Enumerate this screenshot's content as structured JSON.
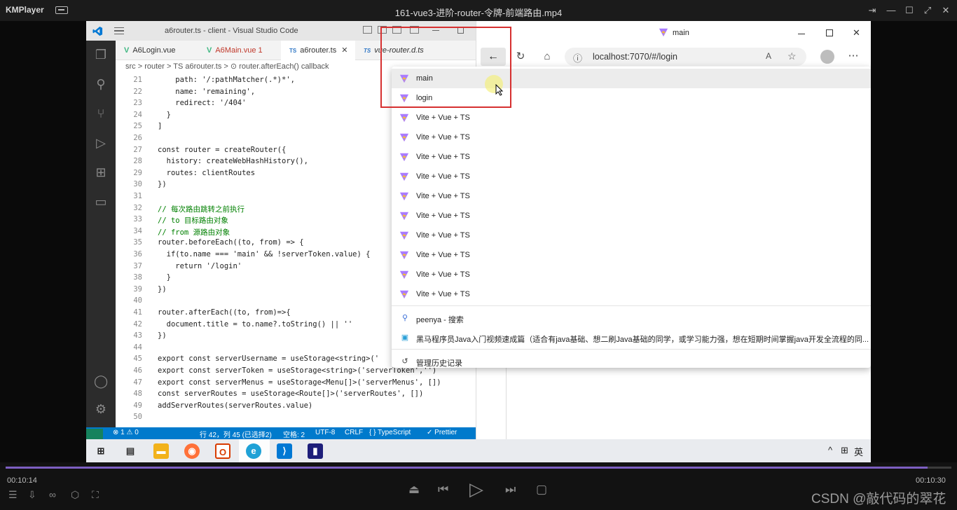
{
  "player": {
    "app_name": "KMPlayer",
    "video_title": "161-vue3-进阶-router-令牌-前端路由.mp4",
    "time_current": "00:10:14",
    "time_total": "00:10:30",
    "progress_fraction": 0.975,
    "watermark": "CSDN @敲代码的翠花"
  },
  "vscode": {
    "window_title": "a6router.ts - client - Visual Studio Code",
    "tabs": [
      {
        "kind": "V",
        "label": "A6Login.vue"
      },
      {
        "kind": "V",
        "label": "A6Main.vue 1"
      },
      {
        "kind": "TS",
        "label": "a6router.ts"
      },
      {
        "kind": "TS",
        "label": "vue-router.d.ts"
      }
    ],
    "breadcrumb": "src  >  router  >  TS  a6router.ts  >  ⊙ router.afterEach() callback",
    "code_lines": [
      {
        "n": "21",
        "t": "    path: '/:pathMatcher(.*)*',"
      },
      {
        "n": "22",
        "t": "    name: 'remaining',"
      },
      {
        "n": "23",
        "t": "    redirect: '/404'"
      },
      {
        "n": "24",
        "t": "  }"
      },
      {
        "n": "25",
        "t": "]"
      },
      {
        "n": "26",
        "t": ""
      },
      {
        "n": "27",
        "t": "const router = createRouter({"
      },
      {
        "n": "28",
        "t": "  history: createWebHashHistory(),"
      },
      {
        "n": "29",
        "t": "  routes: clientRoutes"
      },
      {
        "n": "30",
        "t": "})"
      },
      {
        "n": "31",
        "t": ""
      },
      {
        "n": "32",
        "t": "// 每次路由跳转之前执行"
      },
      {
        "n": "33",
        "t": "// to 目标路由对象"
      },
      {
        "n": "34",
        "t": "// from 源路由对象"
      },
      {
        "n": "35",
        "t": "router.beforeEach((to, from) => {"
      },
      {
        "n": "36",
        "t": "  if(to.name === 'main' && !serverToken.value) {"
      },
      {
        "n": "37",
        "t": "    return '/login'"
      },
      {
        "n": "38",
        "t": "  }"
      },
      {
        "n": "39",
        "t": "})"
      },
      {
        "n": "40",
        "t": ""
      },
      {
        "n": "41",
        "t": "router.afterEach((to, from)=>{"
      },
      {
        "n": "42",
        "t": "  document.title = to.name?.toString() || ''"
      },
      {
        "n": "43",
        "t": "})"
      },
      {
        "n": "44",
        "t": ""
      },
      {
        "n": "45",
        "t": "export const serverUsername = useStorage<string>('"
      },
      {
        "n": "46",
        "t": "export const serverToken = useStorage<string>('serverToken','')"
      },
      {
        "n": "47",
        "t": "export const serverMenus = useStorage<Menu[]>('serverMenus', [])"
      },
      {
        "n": "48",
        "t": "const serverRoutes = useStorage<Route[]>('serverRoutes', [])"
      },
      {
        "n": "49",
        "t": "addServerRoutes(serverRoutes.value)"
      },
      {
        "n": "50",
        "t": ""
      }
    ],
    "status": {
      "problems": "⊗ 1 ⚠ 0",
      "position": "行 42，列 45 (已选择2)",
      "spaces": "空格: 2",
      "encoding": "UTF-8",
      "eol": "CRLF",
      "language": "{ } TypeScript",
      "prettier": "✓ Prettier"
    }
  },
  "browser": {
    "tab_title": "main",
    "url": "localhost:7070/#/login",
    "history_items": [
      {
        "label": "main",
        "selected": true
      },
      {
        "label": "login",
        "selected": false
      },
      {
        "label": "Vite + Vue + TS",
        "selected": false
      },
      {
        "label": "Vite + Vue + TS",
        "selected": false
      },
      {
        "label": "Vite + Vue + TS",
        "selected": false
      },
      {
        "label": "Vite + Vue + TS",
        "selected": false
      },
      {
        "label": "Vite + Vue + TS",
        "selected": false
      },
      {
        "label": "Vite + Vue + TS",
        "selected": false
      },
      {
        "label": "Vite + Vue + TS",
        "selected": false
      },
      {
        "label": "Vite + Vue + TS",
        "selected": false
      },
      {
        "label": "Vite + Vue + TS",
        "selected": false
      },
      {
        "label": "Vite + Vue + TS",
        "selected": false
      }
    ],
    "search_item": "peenya - 搜索",
    "video_item": "黑马程序员Java入门视频速成篇（适合有java基础、想二刷Java基础的同学，或学习能力强，想在短期时间掌握java开发全流程的同...",
    "manage_history": "管理历史记录"
  },
  "taskbar": {
    "ime": "英",
    "tray_up": "^"
  }
}
